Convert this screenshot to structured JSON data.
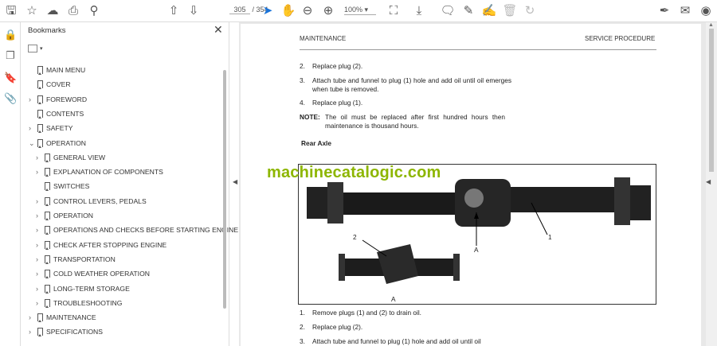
{
  "toolbar": {
    "current_page": "305",
    "total_pages": "/ 354",
    "zoom": "100%",
    "icons": [
      "save-icon",
      "bookmark-star-icon",
      "upload-icon",
      "print-icon",
      "search-icon",
      "page-up-icon",
      "page-down-icon",
      "select-cursor-icon",
      "hand-icon",
      "zoom-out-icon",
      "zoom-in-icon",
      "fit-page-icon",
      "scroll-mode-icon",
      "comment-icon",
      "highlight-icon",
      "draw-icon",
      "delete-icon",
      "rotate-icon",
      "sign-icon",
      "email-icon",
      "account-icon"
    ]
  },
  "panel": {
    "title": "Bookmarks",
    "items": [
      {
        "label": "MAIN MENU",
        "level": 1,
        "expandable": false
      },
      {
        "label": "COVER",
        "level": 1,
        "expandable": false
      },
      {
        "label": "FOREWORD",
        "level": 1,
        "expandable": true
      },
      {
        "label": "CONTENTS",
        "level": 1,
        "expandable": false
      },
      {
        "label": "SAFETY",
        "level": 1,
        "expandable": true
      },
      {
        "label": "OPERATION",
        "level": 1,
        "expandable": true,
        "expanded": true
      },
      {
        "label": "GENERAL VIEW",
        "level": 2,
        "expandable": true
      },
      {
        "label": "EXPLANATION OF COMPONENTS",
        "level": 2,
        "expandable": true
      },
      {
        "label": "SWITCHES",
        "level": 2,
        "expandable": false
      },
      {
        "label": "CONTROL LEVERS, PEDALS",
        "level": 2,
        "expandable": true
      },
      {
        "label": "OPERATION",
        "level": 2,
        "expandable": true
      },
      {
        "label": "OPERATIONS AND CHECKS BEFORE STARTING ENGINE",
        "level": 2,
        "expandable": true
      },
      {
        "label": "CHECK AFTER STOPPING ENGINE",
        "level": 2,
        "expandable": true
      },
      {
        "label": "TRANSPORTATION",
        "level": 2,
        "expandable": true
      },
      {
        "label": "COLD WEATHER OPERATION",
        "level": 2,
        "expandable": true
      },
      {
        "label": "LONG-TERM STORAGE",
        "level": 2,
        "expandable": true
      },
      {
        "label": "TROUBLESHOOTING",
        "level": 2,
        "expandable": true
      },
      {
        "label": "MAINTENANCE",
        "level": 1,
        "expandable": true
      },
      {
        "label": "SPECIFICATIONS",
        "level": 1,
        "expandable": true
      }
    ]
  },
  "document": {
    "header_left": "MAINTENANCE",
    "header_right": "SERVICE PROCEDURE",
    "steps_top": [
      {
        "num": "2.",
        "text": "Replace plug (2)."
      },
      {
        "num": "3.",
        "text": "Attach tube and funnel to plug (1) hole and add oil until oil emerges when tube is removed."
      },
      {
        "num": "4.",
        "text": "Replace plug (1)."
      }
    ],
    "note_label": "NOTE:",
    "note_text": "The oil must be replaced after first hundred hours then maintenance is thousand hours.",
    "section_title": "Rear Axle",
    "watermark": "machinecatalogic.com",
    "figure_labels": {
      "a1": "A",
      "a2": "A",
      "n1": "1",
      "n2": "2"
    },
    "steps_bottom": [
      {
        "num": "1.",
        "text": "Remove plugs (1) and (2) to drain oil."
      },
      {
        "num": "2.",
        "text": "Replace plug (2)."
      },
      {
        "num": "3.",
        "text": "Attach tube and funnel to plug (1) hole and add oil until oil"
      }
    ]
  }
}
